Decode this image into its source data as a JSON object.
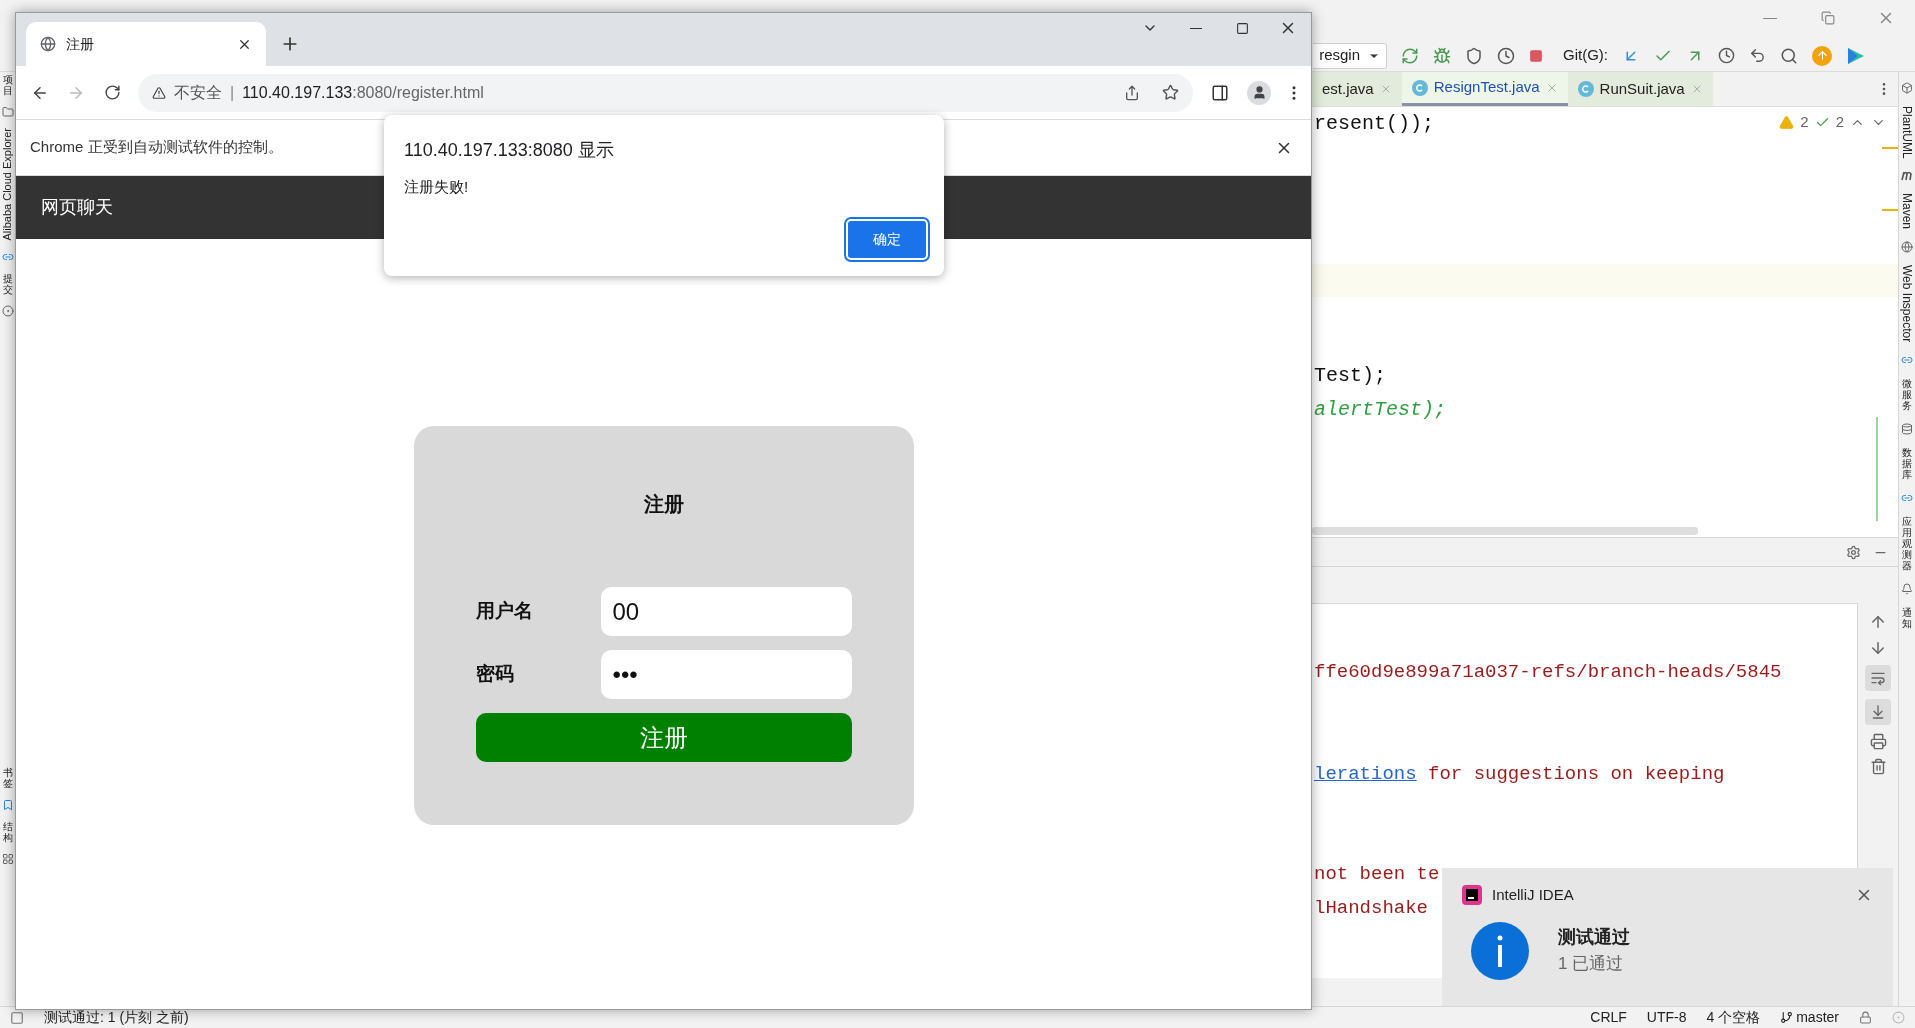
{
  "ide": {
    "toolbar": {
      "run_config": "resgin",
      "git_label": "Git(G):"
    },
    "tabs": [
      {
        "label": "est.java",
        "selected": false
      },
      {
        "label": "ResignTest.java",
        "selected": true
      },
      {
        "label": "RunSuit.java",
        "selected": false
      }
    ],
    "inspection": {
      "warnings": "2",
      "checks": "2"
    },
    "code_lines": [
      {
        "text": "resent());",
        "kind": "code"
      },
      {
        "text": "Test);",
        "kind": "code"
      },
      {
        "text": "alertTest);",
        "kind": "comment"
      }
    ],
    "left_strip": [
      {
        "label": "项目",
        "kind": "cjk"
      },
      {
        "label": "Alibaba Cloud Explorer",
        "kind": "latin"
      },
      {
        "label": "提交",
        "kind": "cjk"
      },
      {
        "label": "书签",
        "kind": "cjk"
      },
      {
        "label": "结构",
        "kind": "cjk"
      }
    ],
    "right_strip": [
      {
        "label": "PlantUML",
        "kind": "latin"
      },
      {
        "label": "Maven",
        "kind": "latin"
      },
      {
        "label": "Web Inspector",
        "kind": "latin"
      },
      {
        "label": "微服务",
        "kind": "cjk"
      },
      {
        "label": "数据库",
        "kind": "cjk"
      },
      {
        "label": "应用观测器",
        "kind": "cjk"
      },
      {
        "label": "通知",
        "kind": "cjk"
      }
    ],
    "console_lines": [
      {
        "text": "ffe60d9e899a71a037-refs/branch-heads/5845"
      },
      {
        "link": "lerations",
        "text": " for suggestions on keeping"
      },
      {
        "text": "not been te"
      },
      {
        "text": "lHandshake"
      }
    ],
    "status_left": "测试通过: 1 (片刻 之前)",
    "status_right": [
      "CRLF",
      "UTF-8",
      "4 个空格",
      "master"
    ]
  },
  "browser": {
    "tab": {
      "title": "注册",
      "selected": true
    },
    "forward_disabled": true,
    "address": {
      "security": "不安全",
      "separator": "|",
      "host": "110.40.197.133",
      "path": ":8080/register.html"
    },
    "infobar": "Chrome 正受到自动测试软件的控制。",
    "page": {
      "header": "网页聊天",
      "form_title": "注册",
      "fields": [
        {
          "label": "用户名",
          "value": "00"
        },
        {
          "label": "密码",
          "value": "•••"
        }
      ],
      "submit": "注册"
    }
  },
  "alert": {
    "title": "110.40.197.133:8080 显示",
    "message": "注册失败!",
    "ok": "确定"
  },
  "notification": {
    "app": "IntelliJ IDEA",
    "title": "测试通过",
    "body": "1 已通过"
  }
}
